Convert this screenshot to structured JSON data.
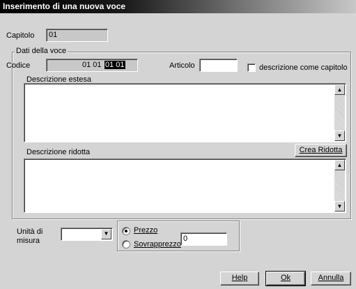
{
  "window": {
    "title": "Inserimento di una nuova voce"
  },
  "capitolo": {
    "label": "Capitolo",
    "value": "01"
  },
  "dati": {
    "group_label": "Dati della voce",
    "codice_label": "Codice",
    "codice_prefix": "01 01",
    "codice_selected": "01 01",
    "articolo_label": "Articolo",
    "articolo_value": "",
    "checkbox_label": "descrizione come capitolo"
  },
  "descrizione_estesa": {
    "label": "Descrizione estesa",
    "value": ""
  },
  "descrizione_ridotta": {
    "label": "Descrizione ridotta",
    "value": "",
    "button": "Crea Ridotta"
  },
  "unita": {
    "label_line1": "Unità di",
    "label_line2": "misura",
    "value": ""
  },
  "prezzo": {
    "option1": "Prezzo",
    "option2": "Sovrapprezzo",
    "selected": "Prezzo",
    "value": "0"
  },
  "buttons": {
    "help": "Help",
    "ok": "Ok",
    "annulla": "Annulla"
  },
  "icons": {
    "scroll_up": "scroll-up-arrow",
    "scroll_down": "scroll-down-arrow",
    "dropdown": "chevron-down"
  }
}
